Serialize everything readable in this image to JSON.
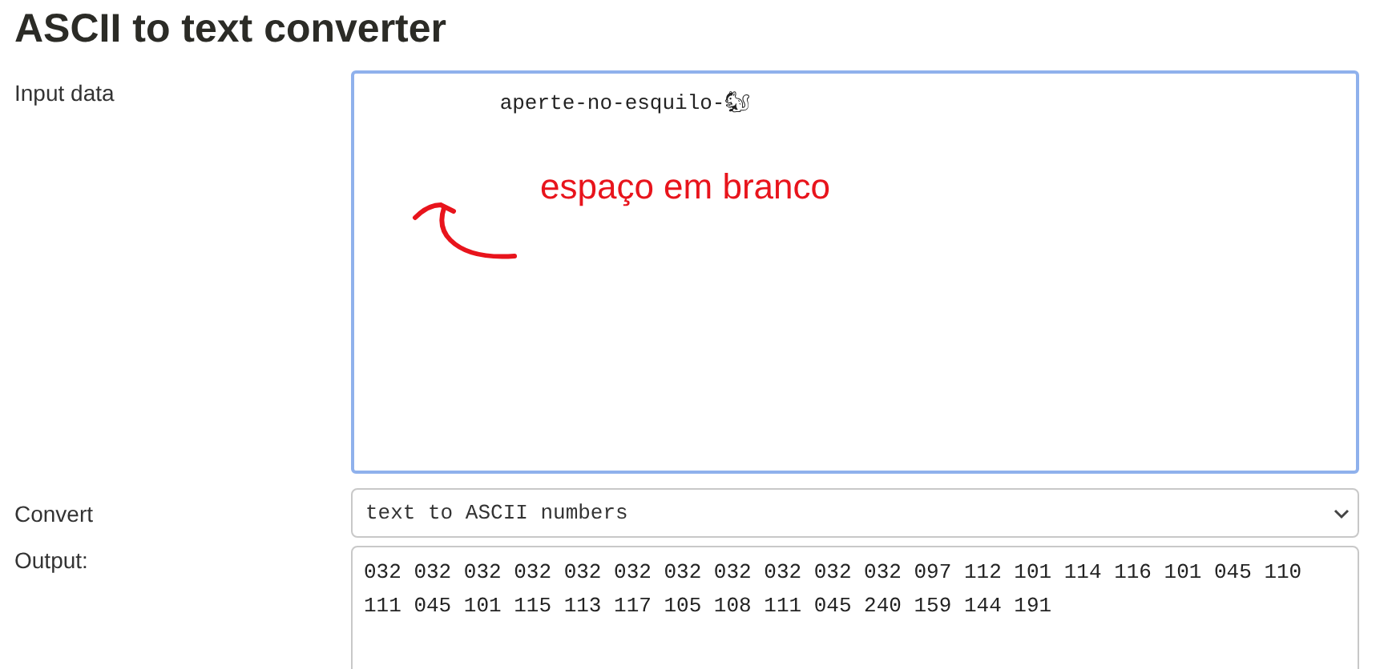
{
  "title": "ASCII to text converter",
  "input": {
    "label": "Input data",
    "value": "           aperte-no-esquilo-🐿"
  },
  "annotation": {
    "text": "espaço em branco"
  },
  "convert": {
    "label": "Convert",
    "value": "text to ASCII numbers"
  },
  "output": {
    "label": "Output:",
    "value": "032 032 032 032 032 032 032 032 032 032 032 097 112 101 114 116 101 045 110 111 045 101 115 113 117 105 108 111 045 240 159 144 191"
  }
}
